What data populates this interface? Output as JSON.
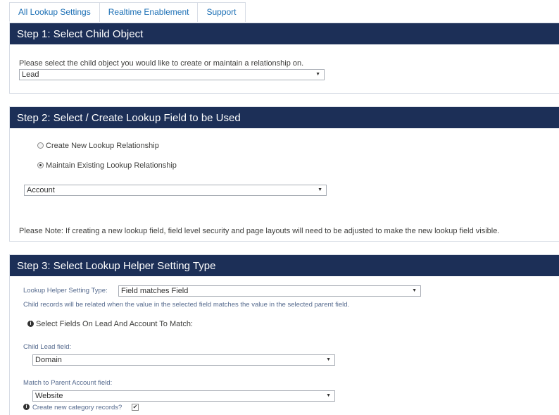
{
  "tabs": [
    {
      "label": "All Lookup Settings"
    },
    {
      "label": "Realtime Enablement"
    },
    {
      "label": "Support"
    }
  ],
  "step1": {
    "title": "Step 1: Select Child Object",
    "prompt": "Please select the child object you would like to create or maintain a relationship on.",
    "child_object": "Lead"
  },
  "step2": {
    "title": "Step 2: Select / Create Lookup Field to be Used",
    "option_new": "Create New Lookup Relationship",
    "option_existing": "Maintain Existing Lookup Relationship",
    "selected_option": "existing",
    "lookup_field": "Account",
    "note": "Please Note: If creating a new lookup field, field level security and page layouts will need to be adjusted to make the new lookup field visible."
  },
  "step3": {
    "title": "Step 3: Select Lookup Helper Setting Type",
    "setting_type_label": "Lookup Helper Setting Type:",
    "setting_type_value": "Field matches Field",
    "setting_type_help": "Child records will be related when the value in the selected field matches the value in the selected parent field.",
    "match_heading": "Select Fields On Lead And Account To Match:",
    "child_field_label": "Child Lead field:",
    "child_field_value": "Domain",
    "parent_field_label": "Match to Parent Account field:",
    "parent_field_value": "Website",
    "create_category_label": "Create new category records?",
    "create_category_checked": true
  }
}
